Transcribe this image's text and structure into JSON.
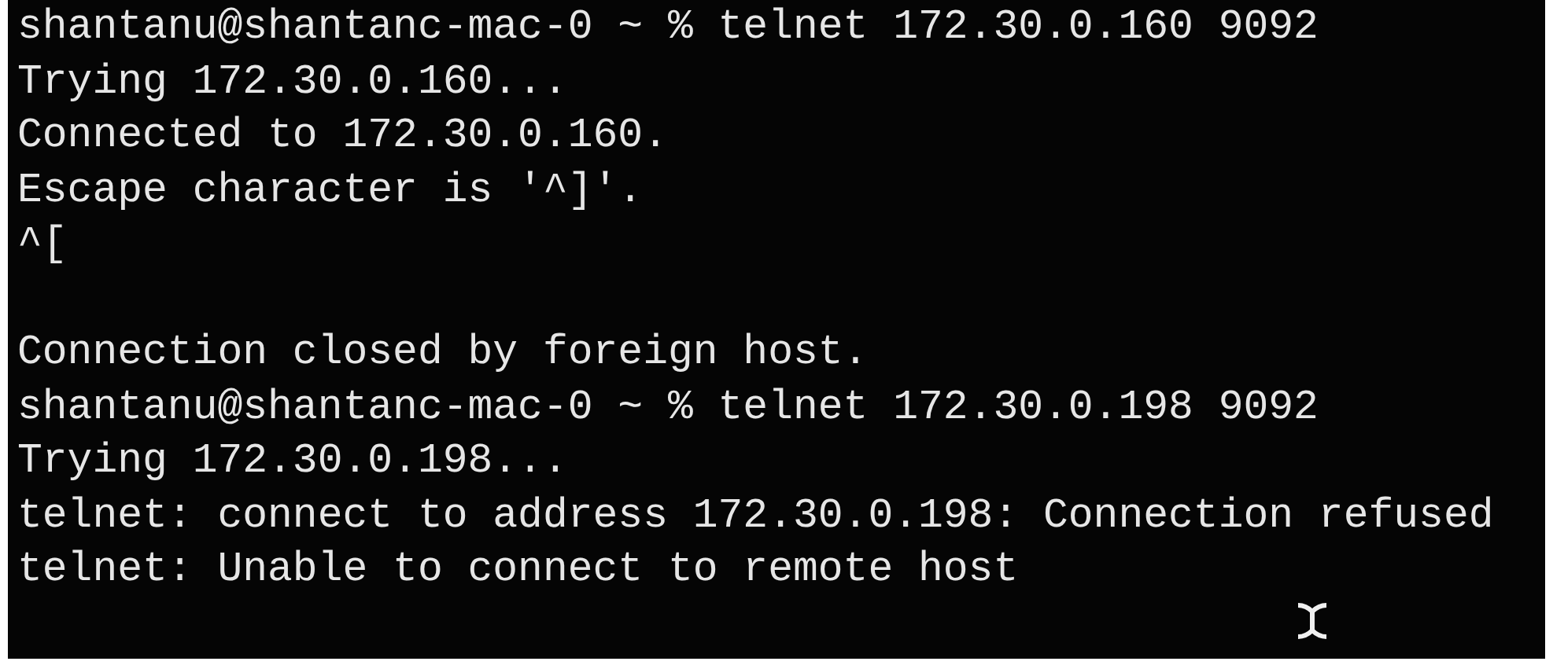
{
  "terminal": {
    "lines": [
      {
        "kind": "text",
        "text": "shantanu@shantanc-mac-0 ~ % telnet 172.30.0.160 9092"
      },
      {
        "kind": "text",
        "text": "Trying 172.30.0.160..."
      },
      {
        "kind": "text",
        "text": "Connected to 172.30.0.160."
      },
      {
        "kind": "text",
        "text": "Escape character is '^]'."
      },
      {
        "kind": "text",
        "text": "^["
      },
      {
        "kind": "blank"
      },
      {
        "kind": "text",
        "text": "Connection closed by foreign host."
      },
      {
        "kind": "text",
        "text": "shantanu@shantanc-mac-0 ~ % telnet 172.30.0.198 9092"
      },
      {
        "kind": "text",
        "text": "Trying 172.30.0.198..."
      },
      {
        "kind": "text",
        "text": "telnet: connect to address 172.30.0.198: Connection refused"
      },
      {
        "kind": "text",
        "text": "telnet: Unable to connect to remote host"
      }
    ]
  }
}
